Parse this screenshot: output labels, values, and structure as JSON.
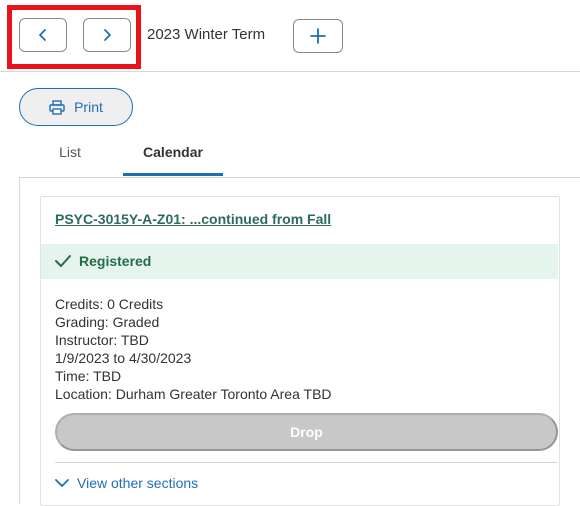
{
  "header": {
    "term": "2023 Winter Term",
    "prev_icon": "chevron-left-icon",
    "next_icon": "chevron-right-icon",
    "add_icon": "plus-icon"
  },
  "actions": {
    "print_label": "Print",
    "print_icon": "printer-icon"
  },
  "tabs": [
    {
      "label": "List",
      "active": false
    },
    {
      "label": "Calendar",
      "active": true
    }
  ],
  "course": {
    "title": "PSYC-3015Y-A-Z01: ...continued from Fall",
    "status": "Registered",
    "details": [
      "Credits: 0 Credits",
      "Grading: Graded",
      "Instructor: TBD",
      "1/9/2023 to 4/30/2023",
      "Time: TBD",
      "Location: Durham Greater Toronto Area TBD"
    ],
    "drop_label": "Drop",
    "view_other_label": "View other sections"
  },
  "colors": {
    "accent": "#1e6fb4",
    "status_bg": "#e6f4ee",
    "status_text": "#236d47",
    "highlight": "#e8131b",
    "disabled_button": "#c8c8c8"
  }
}
